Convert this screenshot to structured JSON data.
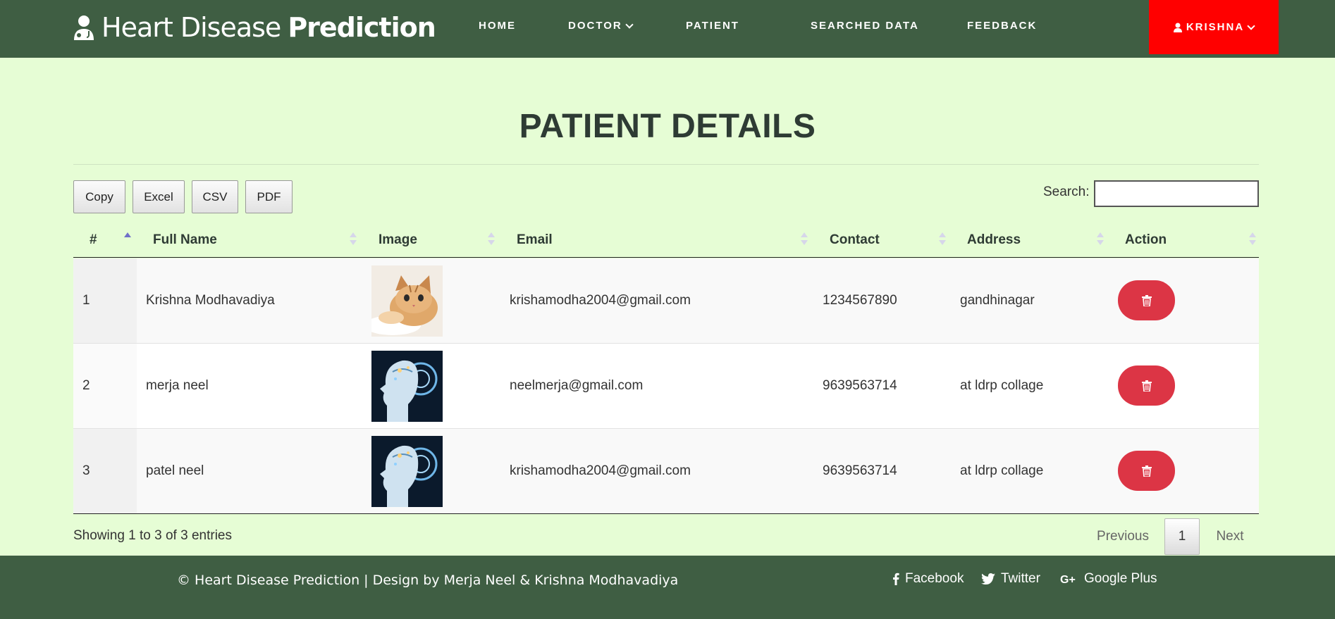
{
  "brand": {
    "part1": "Heart Disease",
    "part2": "Prediction"
  },
  "nav": {
    "home": "HOME",
    "doctor": "DOCTOR",
    "patient": "PATIENT",
    "searched": "SEARCHED DATA",
    "feedback": "FEEDBACK",
    "user": "KRISHNA"
  },
  "page": {
    "title": "PATIENT DETAILS"
  },
  "toolbar": {
    "copy": "Copy",
    "excel": "Excel",
    "csv": "CSV",
    "pdf": "PDF",
    "search_label": "Search:",
    "search_value": ""
  },
  "table": {
    "headers": [
      "#",
      "Full Name",
      "Image",
      "Email",
      "Contact",
      "Address",
      "Action"
    ],
    "rows": [
      {
        "id": "1",
        "name": "Krishna Modhavadiya",
        "image": "kitten-photo",
        "email": "krishamodha2004@gmail.com",
        "contact": "1234567890",
        "address": "gandhinagar"
      },
      {
        "id": "2",
        "name": "merja neel",
        "image": "ai-head-photo",
        "email": "neelmerja@gmail.com",
        "contact": "9639563714",
        "address": "at ldrp collage"
      },
      {
        "id": "3",
        "name": "patel neel",
        "image": "ai-head-photo",
        "email": "krishamodha2004@gmail.com",
        "contact": "9639563714",
        "address": "at ldrp collage"
      }
    ]
  },
  "pagination": {
    "info": "Showing 1 to 3 of 3 entries",
    "previous": "Previous",
    "current": "1",
    "next": "Next"
  },
  "footer": {
    "copyright": "© Heart Disease Prediction | Design by Merja Neel & Krishna Modhavadiya",
    "facebook": "Facebook",
    "twitter": "Twitter",
    "googleplus": "Google Plus"
  },
  "colors": {
    "nav_bg": "#3f5e43",
    "page_bg": "#e6fdd5",
    "user_btn": "#ff0000",
    "delete_btn": "#dc3545"
  }
}
